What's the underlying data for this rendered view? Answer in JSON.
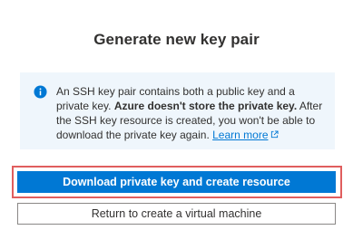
{
  "dialog": {
    "title": "Generate new key pair"
  },
  "info": {
    "icon": "info-icon",
    "text_before": "An SSH key pair contains both a public key and a private key. ",
    "text_bold": "Azure doesn't store the private key.",
    "text_after": " After the SSH key resource is created, you won't be able to download the private key again. ",
    "learn_more": "Learn more",
    "learn_more_icon": "external-link-icon"
  },
  "actions": {
    "download_label": "Download private key and create resource",
    "return_label": "Return to create a virtual machine"
  },
  "colors": {
    "accent": "#0078d4",
    "info_background": "#eff6fc",
    "highlight_border": "#e05e5e"
  }
}
